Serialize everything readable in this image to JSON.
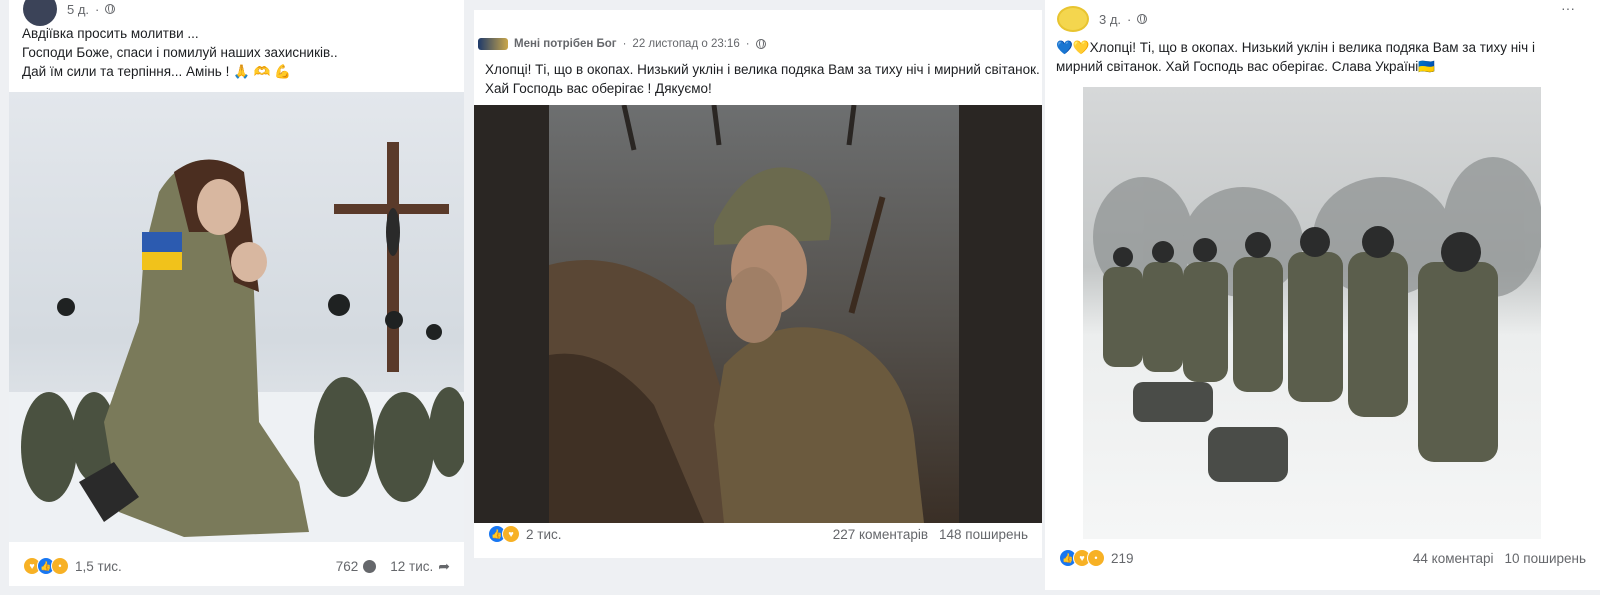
{
  "post1": {
    "time": "5 д.",
    "lines": [
      "Авдіївка просить молитви ...",
      "Господи Боже, спаси і помилуй наших захисників..",
      "Дай їм сили та терпіння... Амінь ! 🙏 🫶 💪"
    ],
    "reactions_count": "1,5 тис.",
    "comments_count": "762",
    "shares_count": "12 тис."
  },
  "post2": {
    "author": "Мені потрібен Бог",
    "time": "22 листопад о 23:16",
    "lines": [
      "Хлопці! Ті, що в окопах. Низький уклін і велика подяка Вам за тиху ніч і мирний світанок.",
      "Хай Господь вас оберігає ! Дякуємо!"
    ],
    "reactions_count": "2 тис.",
    "comments": "227 коментарів",
    "shares": "148 поширень"
  },
  "post3": {
    "time": "3 д.",
    "lines": [
      "💙💛Хлопці! Ті, що в окопах. Низький уклін і велика подяка Вам за тиху ніч і",
      "мирний світанок. Хай Господь вас оберігає. Слава Україні🇺🇦"
    ],
    "more": "···",
    "reactions_count": "219",
    "comments": "44 коментарі",
    "shares": "10 поширень"
  },
  "colors": {
    "like": "#1877f2",
    "love": "#f33e58",
    "care": "#f7b125",
    "text_secondary": "#65676b"
  }
}
